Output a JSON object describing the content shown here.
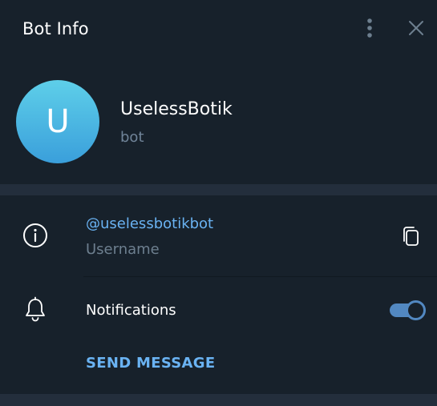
{
  "header": {
    "title": "Bot Info",
    "more_icon": "vertical-dots-icon",
    "close_icon": "close-icon"
  },
  "profile": {
    "avatar_letter": "U",
    "name": "UselessBotik",
    "status": "bot"
  },
  "username_row": {
    "icon": "info-icon",
    "value": "@uselessbotikbot",
    "label": "Username",
    "copy_icon": "copy-icon"
  },
  "notifications_row": {
    "icon": "bell-icon",
    "label": "Notifications",
    "enabled": true
  },
  "actions": {
    "send_message": "SEND MESSAGE"
  },
  "colors": {
    "background": "#17212b",
    "divider": "#232e3c",
    "accent": "#6ab3f3",
    "toggle": "#5288c1",
    "muted_text": "#708499"
  }
}
